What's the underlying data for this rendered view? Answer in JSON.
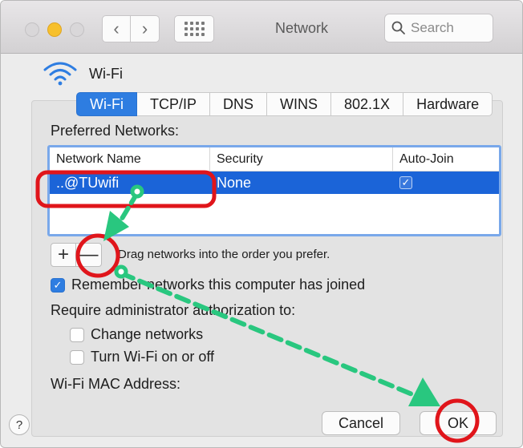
{
  "window": {
    "title": "Network",
    "search_placeholder": "Search"
  },
  "header": {
    "interface_label": "Wi-Fi"
  },
  "tabs": [
    {
      "label": "Wi-Fi"
    },
    {
      "label": "TCP/IP"
    },
    {
      "label": "DNS"
    },
    {
      "label": "WINS"
    },
    {
      "label": "802.1X"
    },
    {
      "label": "Hardware"
    }
  ],
  "preferred": {
    "label": "Preferred Networks:",
    "columns": [
      "Network Name",
      "Security",
      "Auto-Join"
    ],
    "rows": [
      {
        "name": "..@TUwifi",
        "security": "None",
        "autojoin": "✓"
      }
    ],
    "drag_hint": "Drag networks into the order you prefer."
  },
  "options": {
    "remember": "Remember networks this computer has joined",
    "require_label": "Require administrator authorization to:",
    "change_networks": "Change networks",
    "turn_wifi": "Turn Wi-Fi on or off",
    "mac_label": "Wi-Fi MAC Address:"
  },
  "buttons": {
    "cancel": "Cancel",
    "ok": "OK",
    "help": "?",
    "plus": "+",
    "minus": "—"
  },
  "colors": {
    "accent": "#2e7de1",
    "annotation_red": "#e0151b",
    "annotation_green": "#29c77f"
  }
}
